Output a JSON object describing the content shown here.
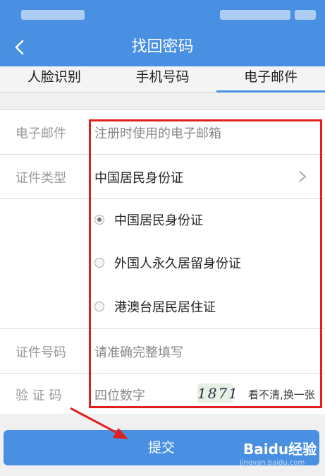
{
  "header": {
    "title": "找回密码"
  },
  "tabs": [
    {
      "label": "人脸识别"
    },
    {
      "label": "手机号码"
    },
    {
      "label": "电子邮件"
    }
  ],
  "form": {
    "email": {
      "label": "电子邮件",
      "placeholder": "注册时使用的电子邮箱"
    },
    "id_type": {
      "label": "证件类型",
      "selected": "中国居民身份证",
      "options": [
        "中国居民身份证",
        "外国人永久居留身份证",
        "港澳台居民居住证"
      ]
    },
    "id_number": {
      "label": "证件号码",
      "placeholder": "请准确完整填写"
    },
    "captcha": {
      "label": "验 证 码",
      "placeholder": "四位数字",
      "image_text": "1871",
      "refresh": "看不清,换一张"
    }
  },
  "submit": {
    "label": "提交"
  },
  "watermark": {
    "brand": "Baidu经验",
    "url": "jingyan.baidu.com"
  },
  "colors": {
    "brand": "#4a90e2",
    "highlight": "#e02020"
  }
}
